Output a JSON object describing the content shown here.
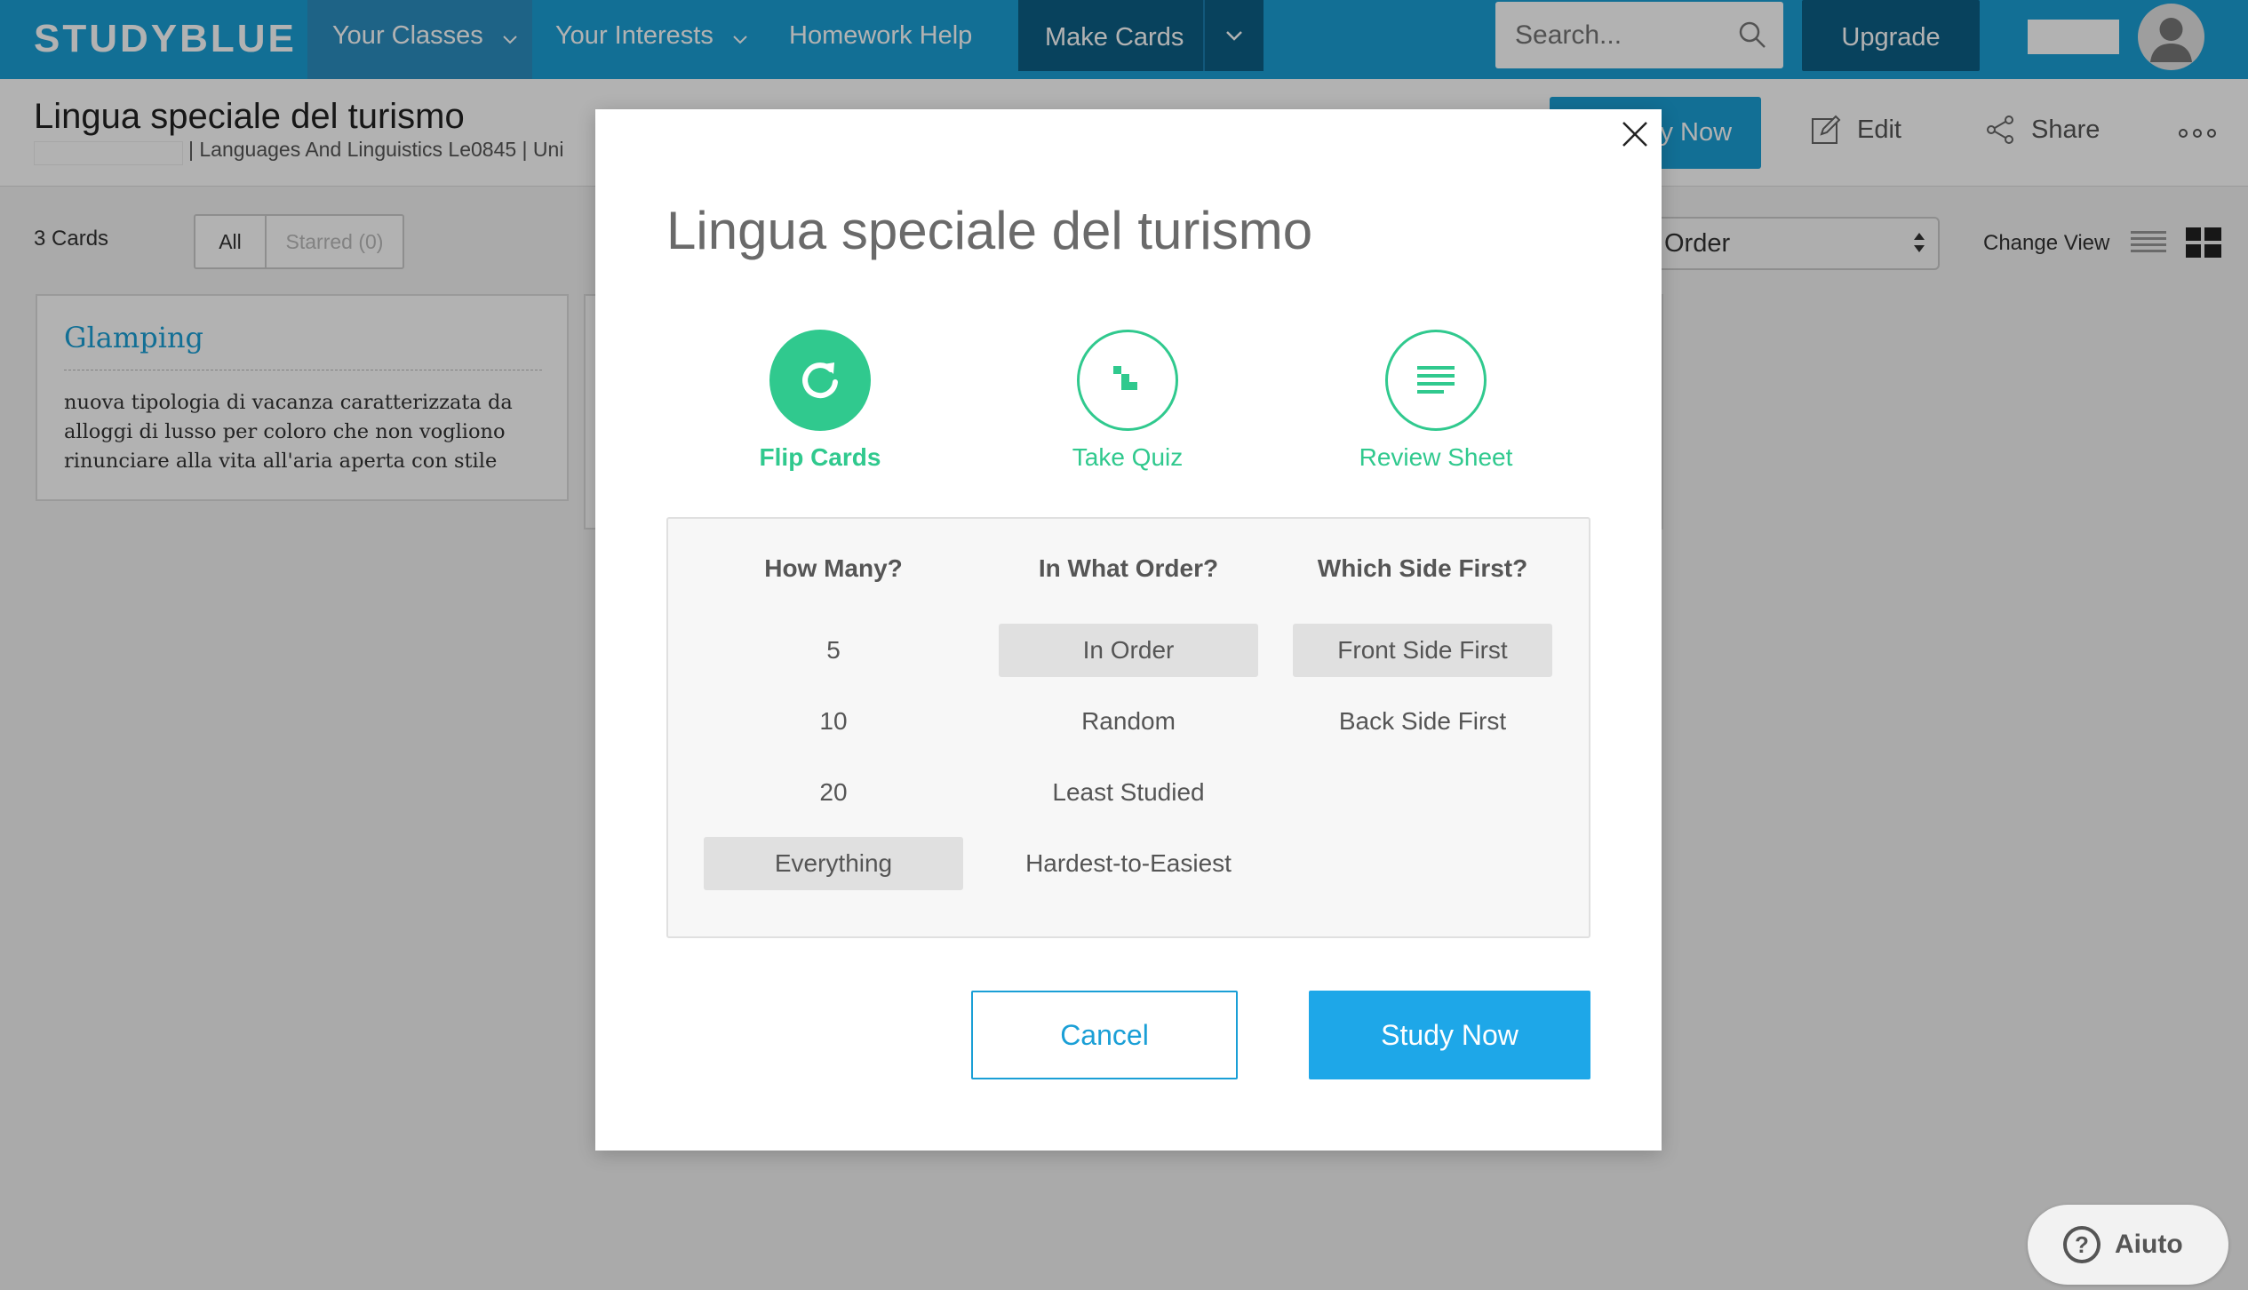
{
  "nav": {
    "logo": "STUDYBLUE",
    "your_classes": "Your Classes",
    "your_interests": "Your Interests",
    "homework_help": "Homework Help",
    "make_cards": "Make Cards",
    "search_placeholder": "Search...",
    "upgrade": "Upgrade"
  },
  "deck": {
    "title": "Lingua speciale del turismo",
    "breadcrumb": "|  Languages And Linguistics Le0845  |  Uni",
    "study_now": "ly Now",
    "edit": "Edit",
    "share": "Share"
  },
  "toolbar": {
    "cards_count": "3 Cards",
    "filter_all": "All",
    "filter_starred": "Starred (0)",
    "order_select": "Order",
    "change_view": "Change View"
  },
  "cards": [
    {
      "term": "Glamping",
      "definition": "nuova tipologia di vacanza caratterizzata da alloggi di lusso per coloro che non vogliono rinunciare alla vita all'aria aperta con stile"
    }
  ],
  "modal": {
    "title": "Lingua speciale del turismo",
    "modes": [
      {
        "label": "Flip Cards",
        "icon": "refresh-icon",
        "selected": true
      },
      {
        "label": "Take Quiz",
        "icon": "quiz-icon",
        "selected": false
      },
      {
        "label": "Review Sheet",
        "icon": "list-lines-icon",
        "selected": false
      }
    ],
    "how_many": {
      "heading": "How Many?",
      "options": [
        "5",
        "10",
        "20",
        "Everything"
      ],
      "selected": "Everything"
    },
    "order": {
      "heading": "In What Order?",
      "options": [
        "In Order",
        "Random",
        "Least Studied",
        "Hardest-to-Easiest"
      ],
      "selected": "In Order"
    },
    "side": {
      "heading": "Which Side First?",
      "options": [
        "Front Side First",
        "Back Side First"
      ],
      "selected": "Front Side First"
    },
    "cancel": "Cancel",
    "study_now": "Study Now"
  },
  "help": {
    "label": "Aiuto"
  },
  "colors": {
    "brand_blue": "#1a9fd6",
    "dark_blue": "#0c5f86",
    "accent_green": "#30c98e",
    "study_button": "#1ea7e8"
  }
}
